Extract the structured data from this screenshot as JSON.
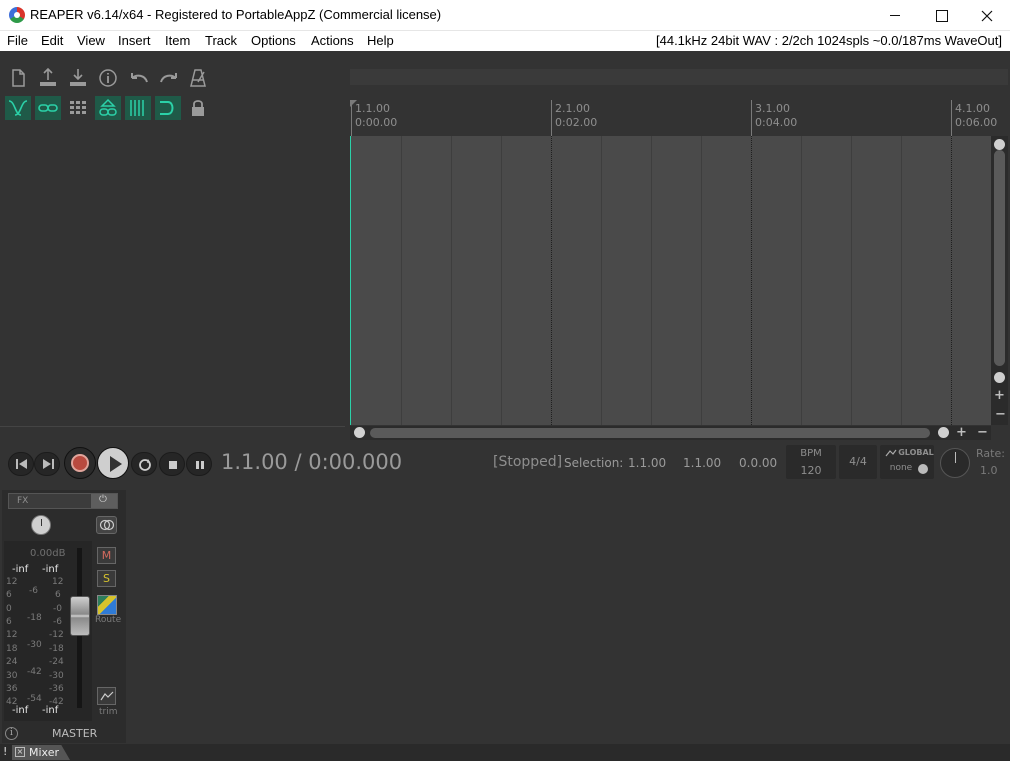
{
  "window": {
    "title": "REAPER v6.14/x64 - Registered to PortableAppZ (Commercial license)",
    "minimize_glyph": "",
    "maximize_glyph": ""
  },
  "menu": {
    "items": [
      "File",
      "Edit",
      "View",
      "Insert",
      "Item",
      "Track",
      "Options",
      "Actions",
      "Help"
    ],
    "status": "[44.1kHz 24bit WAV : 2/2ch 1024spls ~0.0/187ms WaveOut]"
  },
  "toolbar": {
    "icons": [
      "new-project-icon",
      "open-project-icon",
      "save-project-icon",
      "project-settings-icon",
      "undo-icon",
      "redo-icon",
      "metronome-icon",
      "ripple-editing-icon",
      "grouping-icon",
      "grid-icon",
      "snap-icon",
      "item-grouping-icon",
      "auto-crossfade-icon",
      "lock-icon"
    ]
  },
  "ruler": {
    "markers": [
      {
        "measure": "1.1.00",
        "time": "0:00.00"
      },
      {
        "measure": "2.1.00",
        "time": "0:02.00"
      },
      {
        "measure": "3.1.00",
        "time": "0:04.00"
      },
      {
        "measure": "4.1.00",
        "time": "0:06.00"
      }
    ]
  },
  "transport": {
    "position": "1.1.00 / 0:00.000",
    "state": "[Stopped]",
    "selection_label": "Selection:",
    "selection_start": "1.1.00",
    "selection_end": "1.1.00",
    "selection_length": "0.0.00",
    "bpm_label": "BPM",
    "bpm_value": "120",
    "time_signature": "4/4",
    "global_label": "GLOBAL",
    "global_value": "none",
    "rate_label": "Rate:",
    "rate_value": "1.0"
  },
  "master": {
    "fx_label": "FX",
    "db_readout": "0.00dB",
    "peak_left": "-inf",
    "peak_right": "-inf",
    "bottom_left": "-inf",
    "bottom_right": "-inf",
    "scale_left": [
      "12",
      "6",
      "0",
      "6",
      "12",
      "18",
      "24",
      "30",
      "36",
      "42"
    ],
    "scale_mid": [
      "-6",
      "-18",
      "-30",
      "-42",
      "-54"
    ],
    "scale_right": [
      "12",
      "6",
      "-0",
      "-6",
      "-12",
      "-18",
      "-24",
      "-30",
      "-36",
      "-42"
    ],
    "mute_label": "M",
    "solo_label": "S",
    "route_label": "Route",
    "trim_label": "trim",
    "name": "MASTER"
  },
  "dock": {
    "bang": "!",
    "close": "×",
    "tab_label": "Mixer"
  },
  "colors": {
    "accent_cursor": "#2bd1a8",
    "record": "#b84a3f",
    "toolbar_active": "#1f5a48"
  }
}
